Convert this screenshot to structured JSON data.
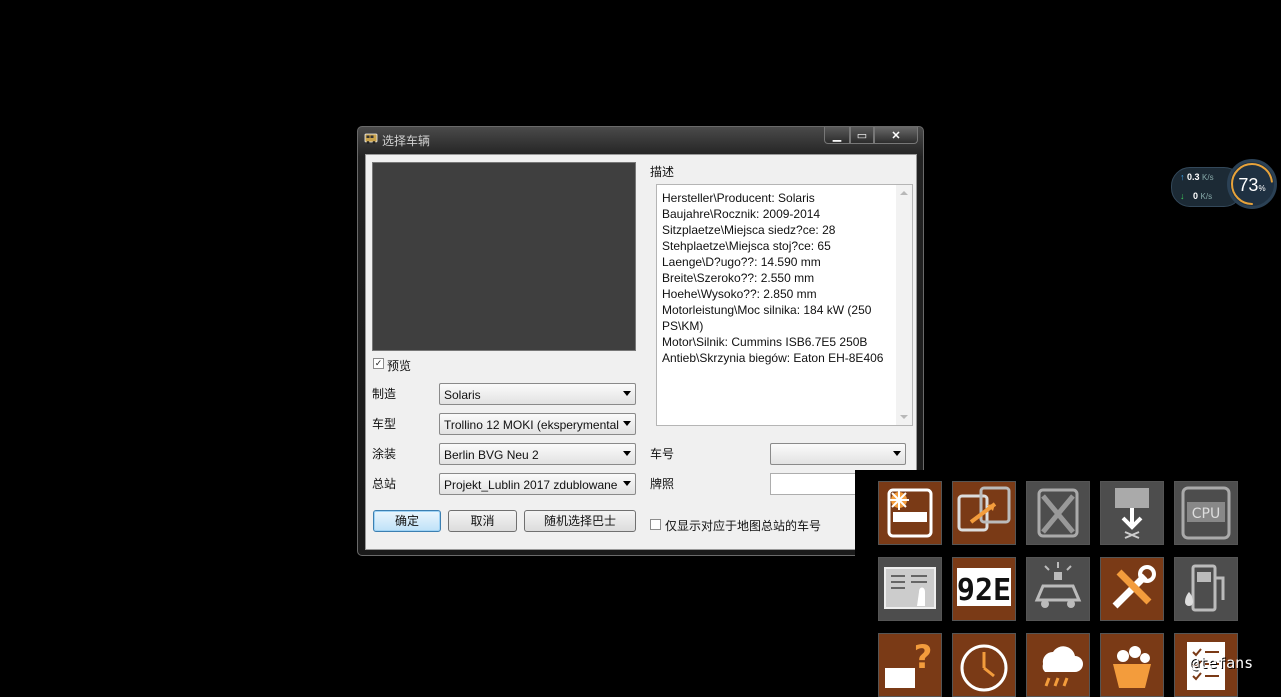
{
  "window": {
    "title": "选择车辆",
    "min_label": "▁",
    "max_label": "▭",
    "close_label": "✕"
  },
  "preview": {
    "checkbox_label": "预览",
    "checked": true,
    "check_mark": "✓"
  },
  "form": {
    "manufacturer_label": "制造",
    "manufacturer_value": "Solaris",
    "model_label": "车型",
    "model_value": "Trollino 12 MOKI (eksperymental",
    "livery_label": "涂装",
    "livery_value": "Berlin BVG Neu 2",
    "depot_label": "总站",
    "depot_value": "Projekt_Lublin 2017 zdublowane"
  },
  "buttons": {
    "ok": "确定",
    "cancel": "取消",
    "random": "随机选择巴士"
  },
  "description": {
    "label": "描述",
    "lines": [
      "Hersteller\\Producent: Solaris",
      "Baujahre\\Rocznik: 2009-2014",
      "Sitzplaetze\\Miejsca siedz?ce: 28",
      "Stehplaetze\\Miejsca stoj?ce: 65",
      "Laenge\\D?ugo??: 14.590 mm",
      "Breite\\Szeroko??: 2.550 mm",
      "Hoehe\\Wysoko??: 2.850 mm",
      "Motorleistung\\Moc silnika: 184 kW (250 PS\\KM)",
      "Motor\\Silnik: Cummins ISB6.7E5 250B",
      "Antieb\\Skrzynia biegów: Eaton EH-8E406"
    ]
  },
  "right_form": {
    "number_label": "车号",
    "number_value": "",
    "plate_label": "牌照",
    "plate_value": "",
    "depot_only_label": "仅显示对应于地图总站的车号",
    "depot_only_checked": false
  },
  "network": {
    "upload": "0.3",
    "upload_unit": "K/s",
    "download": "0",
    "download_unit": "K/s",
    "percent": "73",
    "percent_unit": "%",
    "percent_value": 73
  },
  "toolbar_icons": [
    "bus-fault-icon",
    "bus-swap-icon",
    "bus-remove-icon",
    "bus-unload-icon",
    "bus-cpu-icon",
    "ticket-printer-icon",
    "route-display-icon",
    "police-car-icon",
    "repair-tools-icon",
    "fuel-pump-icon",
    "help-sign-icon",
    "clock-icon",
    "weather-icon",
    "flower-basket-icon",
    "checklist-icon"
  ],
  "watermark": "@tefans"
}
